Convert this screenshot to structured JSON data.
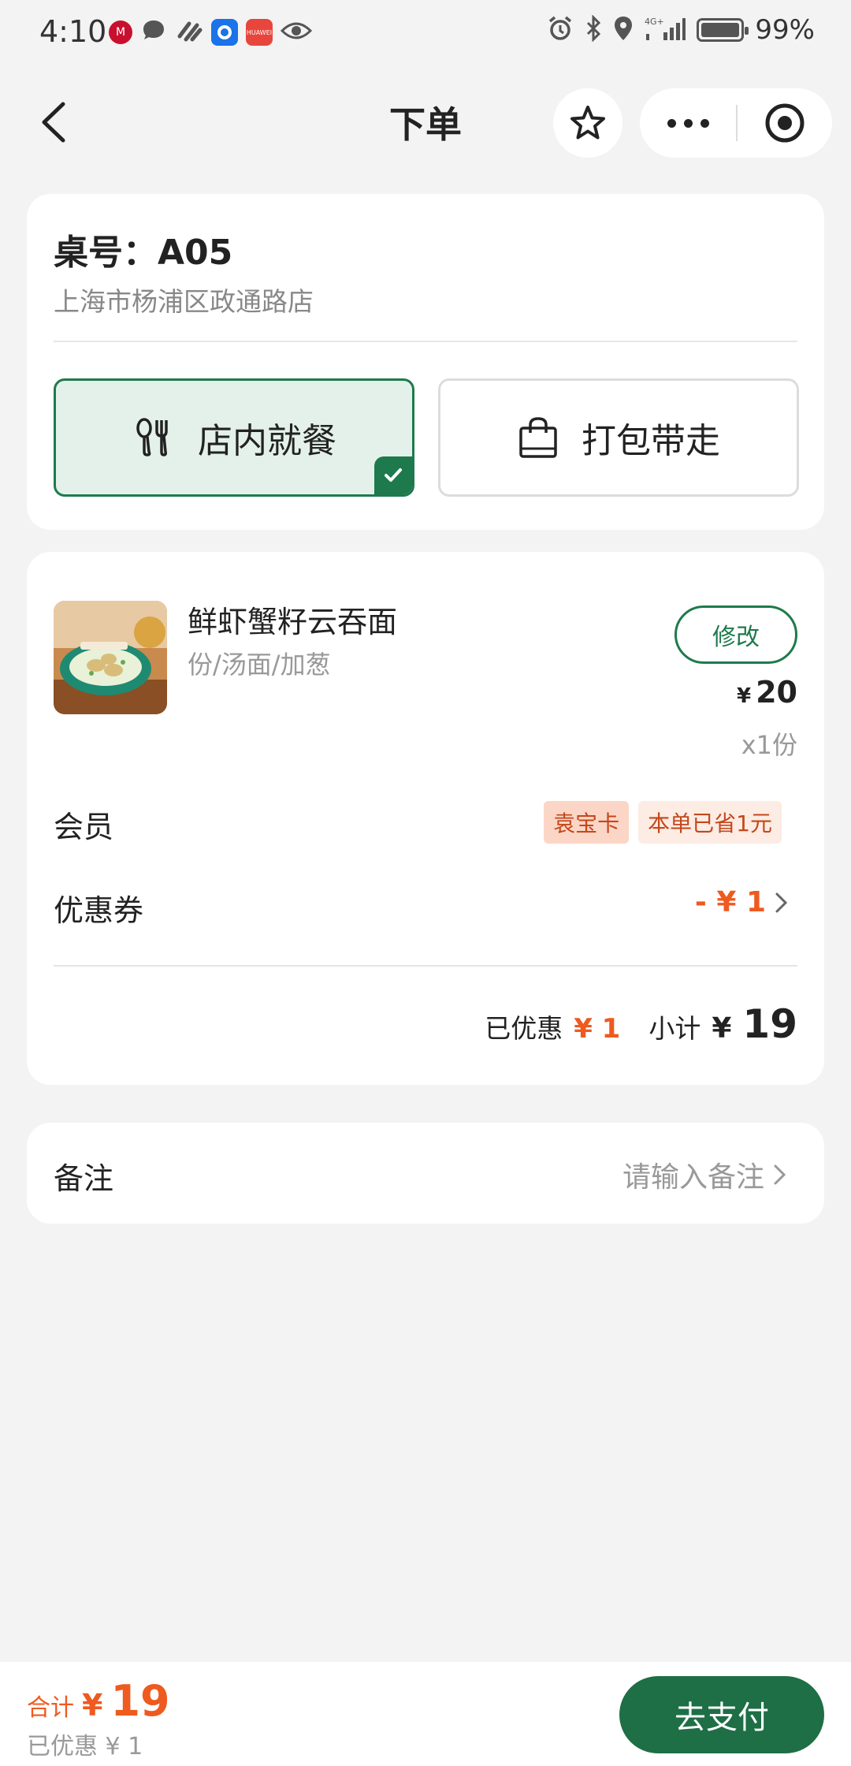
{
  "status_bar": {
    "time": "4:10",
    "battery_text": "99%",
    "battery_level": 0.99,
    "app_icons": [
      "cmb-icon",
      "chat-bubble-icon",
      "link-icon",
      "baidu-app-icon",
      "huawei-store-icon",
      "eye-icon"
    ],
    "system_icons": [
      "alarm-icon",
      "bluetooth-icon",
      "location-icon",
      "signal-4g-icon",
      "battery-icon"
    ]
  },
  "nav": {
    "title": "下单"
  },
  "table_card": {
    "table_no": "桌号：A05",
    "store": "上海市杨浦区政通路店",
    "dine_in_label": "店内就餐",
    "takeaway_label": "打包带走",
    "selected_mode": "dine_in"
  },
  "order": {
    "item": {
      "name": "鲜虾蟹籽云吞面",
      "spec": "份/汤面/加葱",
      "edit_label": "修改",
      "price_symbol": "¥",
      "price": "20",
      "quantity": "x1份"
    },
    "member_label": "会员",
    "member_tags": [
      "袁宝卡",
      "本单已省1元"
    ],
    "coupon_label": "优惠券",
    "coupon_value": "- ¥ 1",
    "discount_label": "已优惠",
    "discount_value": "¥ 1",
    "subtotal_label": "小计",
    "subtotal_symbol": "¥",
    "subtotal_value": "19"
  },
  "remark": {
    "label": "备注",
    "placeholder": "请输入备注"
  },
  "bottom": {
    "total_label": "合计",
    "total_symbol": "¥",
    "total_value": "19",
    "saved_text": "已优惠 ¥ 1",
    "pay_label": "去支付"
  },
  "colors": {
    "brand_green": "#1e7a4c",
    "accent_orange": "#ee5a1f",
    "background": "#f3f3f3"
  }
}
